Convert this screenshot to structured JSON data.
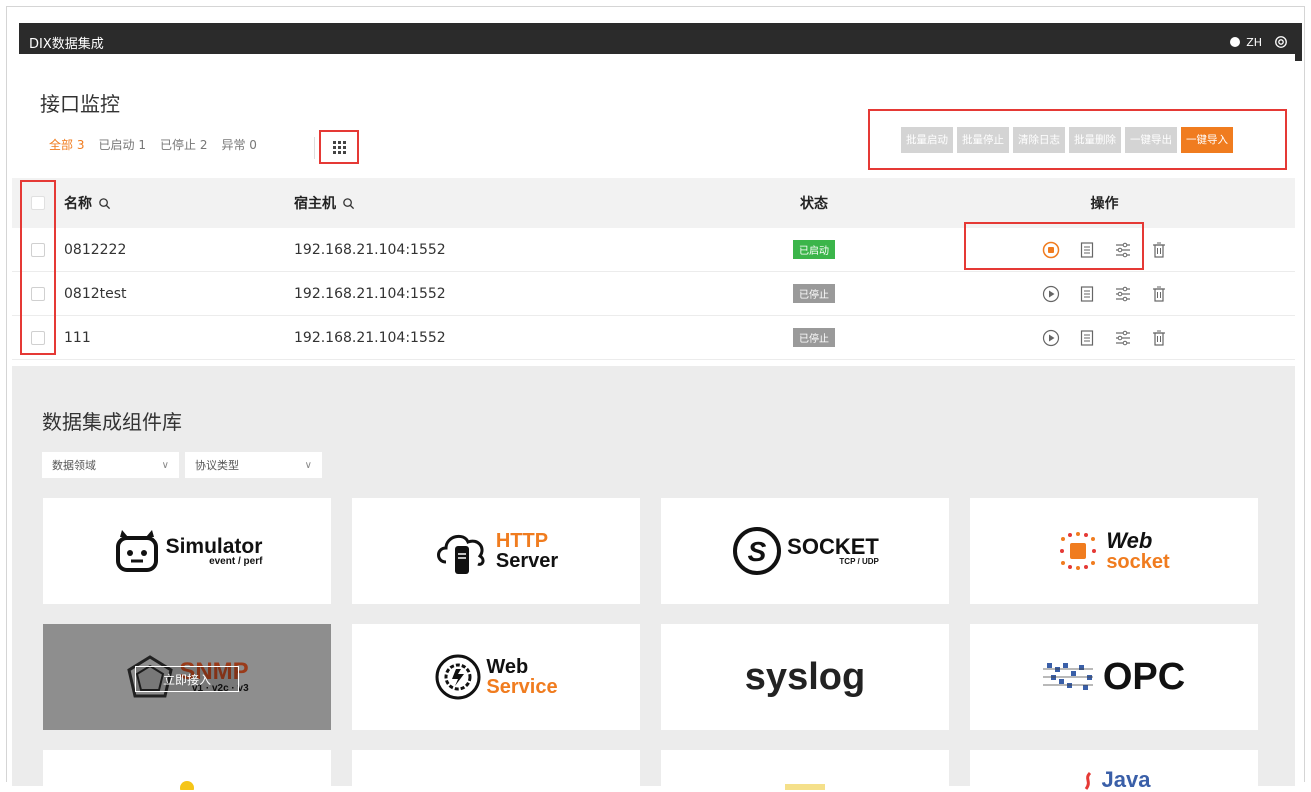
{
  "app": {
    "title": "DIX数据集成",
    "lang": "ZH"
  },
  "monitor": {
    "title": "接口监控",
    "filters": [
      {
        "label": "全部",
        "count": "3",
        "active": true
      },
      {
        "label": "已启动",
        "count": "1"
      },
      {
        "label": "已停止",
        "count": "2"
      },
      {
        "label": "异常",
        "count": "0"
      }
    ],
    "batch": {
      "start": "批量启动",
      "stop": "批量停止",
      "clear_log": "清除日志",
      "delete": "批量删除",
      "export": "一键导出",
      "import": "一键导入"
    },
    "columns": {
      "name": "名称",
      "host": "宿主机",
      "status": "状态",
      "ops": "操作"
    },
    "rows": [
      {
        "name": "0812222",
        "host": "192.168.21.104:1552",
        "status": "已启动",
        "running": true
      },
      {
        "name": "0812test",
        "host": "192.168.21.104:1552",
        "status": "已停止",
        "running": false
      },
      {
        "name": "111",
        "host": "192.168.21.104:1552",
        "status": "已停止",
        "running": false
      }
    ]
  },
  "library": {
    "title": "数据集成组件库",
    "domain_select": "数据领域",
    "protocol_select": "协议类型",
    "connect_label": "立即接入",
    "cards": [
      {
        "icon": "simulator-logo",
        "line1": "Simulator",
        "line2": "event / perf"
      },
      {
        "icon": "http-server-logo",
        "line1": "HTTP",
        "line2": "Server"
      },
      {
        "icon": "socket-logo",
        "line1": "SOCKET",
        "line2": "TCP / UDP"
      },
      {
        "icon": "websocket-logo",
        "line1": "Web",
        "line2": "socket"
      },
      {
        "icon": "snmp-logo",
        "line1": "SNMP",
        "line2": "v1 · v2c · v3"
      },
      {
        "icon": "web-service-logo",
        "line1": "Web",
        "line2": "Service"
      },
      {
        "icon": "syslog-logo",
        "line1": "syslog",
        "line2": ""
      },
      {
        "icon": "opc-logo",
        "line1": "OPC",
        "line2": ""
      },
      {
        "icon": "partial-logo",
        "line1": "",
        "line2": ""
      },
      {
        "icon": "partial-logo",
        "line1": "",
        "line2": ""
      },
      {
        "icon": "partial-logo",
        "line1": "",
        "line2": ""
      },
      {
        "icon": "java-logo",
        "line1": "Java",
        "line2": ""
      }
    ]
  },
  "colors": {
    "accent": "#f07c1f",
    "running": "#3bb54a",
    "stopped": "#9a9a9a",
    "highlight": "#e53935"
  }
}
